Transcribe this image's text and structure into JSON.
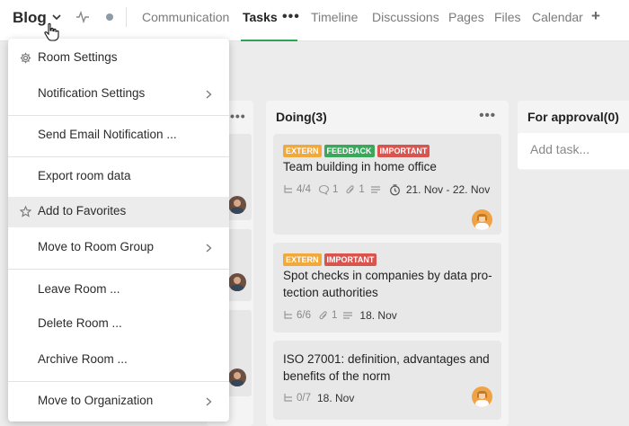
{
  "header": {
    "room_title": "Blog",
    "tabs": [
      "Communication",
      "Tasks",
      "Timeline",
      "Discussions",
      "Pages",
      "Files",
      "Calendar"
    ],
    "active_tab": "Tasks",
    "more_label": "•••",
    "add_label": "+"
  },
  "menu": {
    "items": [
      {
        "label": "Room Settings",
        "icon": "gear-icon"
      },
      {
        "label": "Notification Settings",
        "submenu": true
      },
      {
        "label": "Send Email Notification ..."
      },
      {
        "label": "Export room data"
      },
      {
        "label": "Add to Favorites",
        "icon": "star-icon",
        "hovered": true
      },
      {
        "label": "Move to Room Group",
        "submenu": true
      },
      {
        "label": "Leave Room ..."
      },
      {
        "label": "Delete Room ..."
      },
      {
        "label": "Archive Room ..."
      },
      {
        "label": "Move to Organization",
        "submenu": true
      }
    ]
  },
  "board": {
    "left_column_dots": "•••",
    "doing": {
      "title": "Doing(3)",
      "dots": "•••",
      "cards": [
        {
          "tags": [
            {
              "text": "EXTERN",
              "color": "#f0a93a"
            },
            {
              "text": "FEEDBACK",
              "color": "#3aa85b"
            },
            {
              "text": "IMPORTANT",
              "color": "#d9534f"
            }
          ],
          "title": "Team building in home office",
          "subtasks": "4/4",
          "comments": "1",
          "attachments": "1",
          "dates": "21. Nov - 22. Nov"
        },
        {
          "tags": [
            {
              "text": "EXTERN",
              "color": "#f0a93a"
            },
            {
              "text": "IMPORTANT",
              "color": "#d9534f"
            }
          ],
          "title": "Spot checks in companies by data pro-tection authorities",
          "subtasks": "6/6",
          "attachments": "1",
          "dates": "18. Nov"
        },
        {
          "tags": [],
          "title": "ISO 27001: definition, advantages and benefits of the norm",
          "subtasks": "0/7",
          "dates": "18. Nov"
        }
      ]
    },
    "approval": {
      "title": "For approval(0)",
      "add_placeholder": "Add task..."
    }
  },
  "colors": {
    "accent_green": "#2fa35a",
    "tag_extern": "#f0a93a",
    "tag_feedback": "#3aa85b",
    "tag_important": "#d9534f"
  }
}
